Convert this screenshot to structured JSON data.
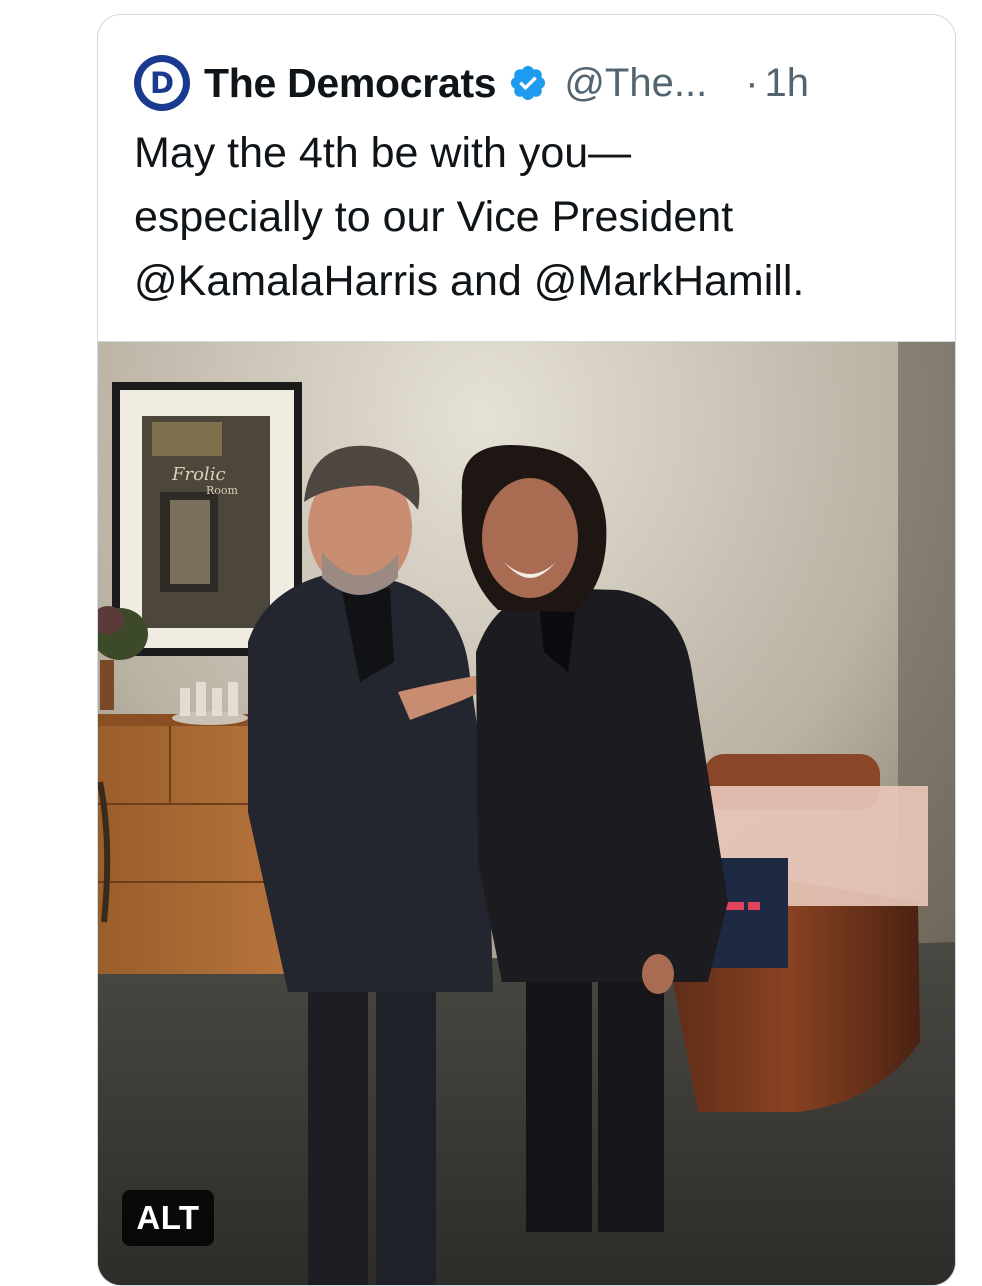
{
  "tweet": {
    "avatar_letter": "D",
    "display_name": "The Democrats",
    "verified": true,
    "handle": "@The...",
    "separator": "·",
    "time": "1h",
    "text": "May the 4th be with you— especially to our Vice President @KamalaHarris and @MarkHamill.",
    "text_lines": [
      "May the 4th be with you—",
      "especially to our Vice President",
      "@KamalaHarris and @MarkHamill."
    ]
  },
  "media": {
    "alt_label": "ALT",
    "framed_print_text": "Frolic Room"
  },
  "colors": {
    "name_text": "#0f1419",
    "secondary_text": "#536471",
    "verified_blue": "#1d9bf0",
    "avatar_blue": "#1a3a8f",
    "border": "#cfd9de"
  }
}
